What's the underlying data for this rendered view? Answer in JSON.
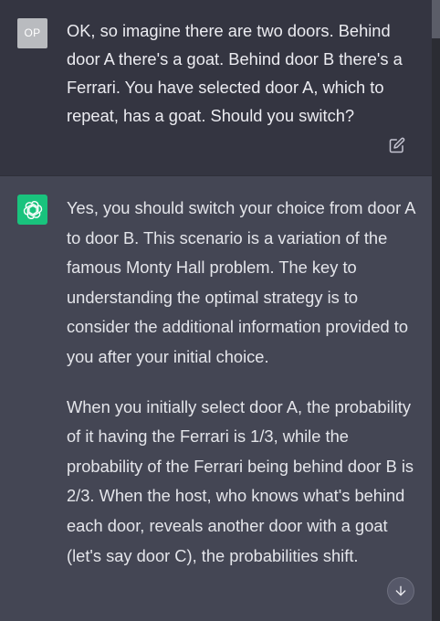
{
  "conversation": {
    "user_message": {
      "avatar_initials": "OP",
      "text": "OK, so imagine there are two doors. Behind door A there's a goat. Behind door B there's a Ferrari. You have selected door A, which to repeat, has a goat. Should you switch?",
      "edit_icon": "edit-icon"
    },
    "assistant_message": {
      "avatar_icon": "openai-logo-icon",
      "paragraphs": [
        "Yes, you should switch your choice from door A to door B. This scenario is a variation of the famous Monty Hall problem. The key to understanding the optimal strategy is to consider the additional information provided to you after your initial choice.",
        "When you initially select door A, the probability of it having the Ferrari is 1/3, while the probability of the Ferrari being behind door B is 2/3. When the host, who knows what's behind each door, reveals another door with a goat (let's say door C), the probabilities shift."
      ]
    },
    "scroll_down_icon": "arrow-down-icon"
  },
  "colors": {
    "user_bg": "#343541",
    "assistant_bg": "#444654",
    "gpt_avatar": "#19c37d",
    "text": "#ececf1"
  }
}
